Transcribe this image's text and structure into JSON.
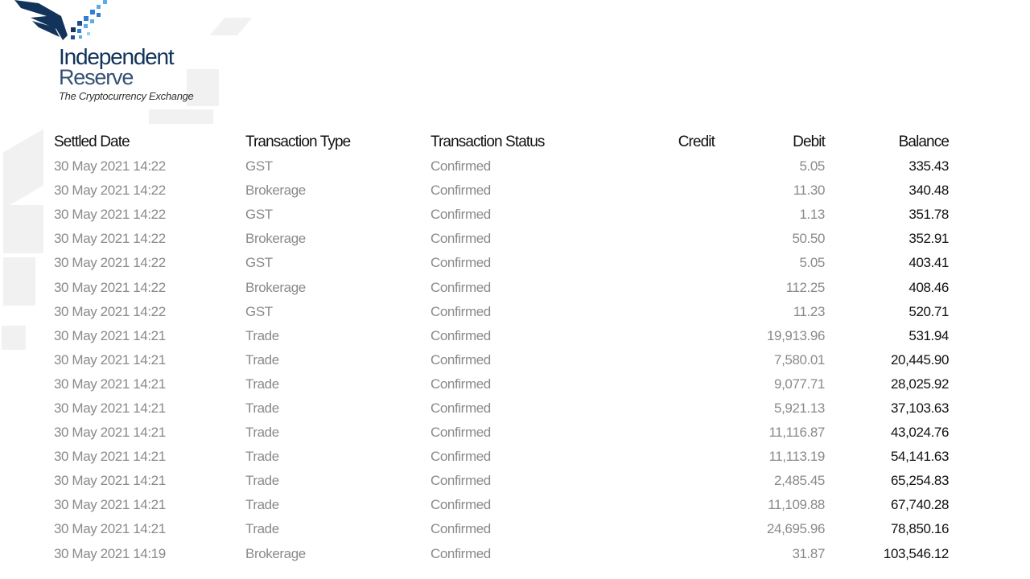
{
  "brand": {
    "name_line1": "Independent",
    "name_line2": "Reserve",
    "tagline": "The Cryptocurrency Exchange",
    "colors": {
      "primary": "#12335a",
      "accent_blue": "#2f7fd6",
      "light_blue": "#5aaee8"
    }
  },
  "table": {
    "headers": {
      "settled_date": "Settled Date",
      "transaction_type": "Transaction Type",
      "transaction_status": "Transaction Status",
      "credit": "Credit",
      "debit": "Debit",
      "balance": "Balance"
    },
    "rows": [
      {
        "date": "30 May 2021 14:22",
        "type": "GST",
        "status": "Confirmed",
        "credit": "",
        "debit": "5.05",
        "balance": "335.43"
      },
      {
        "date": "30 May 2021 14:22",
        "type": "Brokerage",
        "status": "Confirmed",
        "credit": "",
        "debit": "11.30",
        "balance": "340.48"
      },
      {
        "date": "30 May 2021 14:22",
        "type": "GST",
        "status": "Confirmed",
        "credit": "",
        "debit": "1.13",
        "balance": "351.78"
      },
      {
        "date": "30 May 2021 14:22",
        "type": "Brokerage",
        "status": "Confirmed",
        "credit": "",
        "debit": "50.50",
        "balance": "352.91"
      },
      {
        "date": "30 May 2021 14:22",
        "type": "GST",
        "status": "Confirmed",
        "credit": "",
        "debit": "5.05",
        "balance": "403.41"
      },
      {
        "date": "30 May 2021 14:22",
        "type": "Brokerage",
        "status": "Confirmed",
        "credit": "",
        "debit": "112.25",
        "balance": "408.46"
      },
      {
        "date": "30 May 2021 14:22",
        "type": "GST",
        "status": "Confirmed",
        "credit": "",
        "debit": "11.23",
        "balance": "520.71"
      },
      {
        "date": "30 May 2021 14:21",
        "type": "Trade",
        "status": "Confirmed",
        "credit": "",
        "debit": "19,913.96",
        "balance": "531.94"
      },
      {
        "date": "30 May 2021 14:21",
        "type": "Trade",
        "status": "Confirmed",
        "credit": "",
        "debit": "7,580.01",
        "balance": "20,445.90"
      },
      {
        "date": "30 May 2021 14:21",
        "type": "Trade",
        "status": "Confirmed",
        "credit": "",
        "debit": "9,077.71",
        "balance": "28,025.92"
      },
      {
        "date": "30 May 2021 14:21",
        "type": "Trade",
        "status": "Confirmed",
        "credit": "",
        "debit": "5,921.13",
        "balance": "37,103.63"
      },
      {
        "date": "30 May 2021 14:21",
        "type": "Trade",
        "status": "Confirmed",
        "credit": "",
        "debit": "11,116.87",
        "balance": "43,024.76"
      },
      {
        "date": "30 May 2021 14:21",
        "type": "Trade",
        "status": "Confirmed",
        "credit": "",
        "debit": "11,113.19",
        "balance": "54,141.63"
      },
      {
        "date": "30 May 2021 14:21",
        "type": "Trade",
        "status": "Confirmed",
        "credit": "",
        "debit": "2,485.45",
        "balance": "65,254.83"
      },
      {
        "date": "30 May 2021 14:21",
        "type": "Trade",
        "status": "Confirmed",
        "credit": "",
        "debit": "11,109.88",
        "balance": "67,740.28"
      },
      {
        "date": "30 May 2021 14:21",
        "type": "Trade",
        "status": "Confirmed",
        "credit": "",
        "debit": "24,695.96",
        "balance": "78,850.16"
      },
      {
        "date": "30 May 2021 14:19",
        "type": "Brokerage",
        "status": "Confirmed",
        "credit": "",
        "debit": "31.87",
        "balance": "103,546.12"
      }
    ]
  }
}
